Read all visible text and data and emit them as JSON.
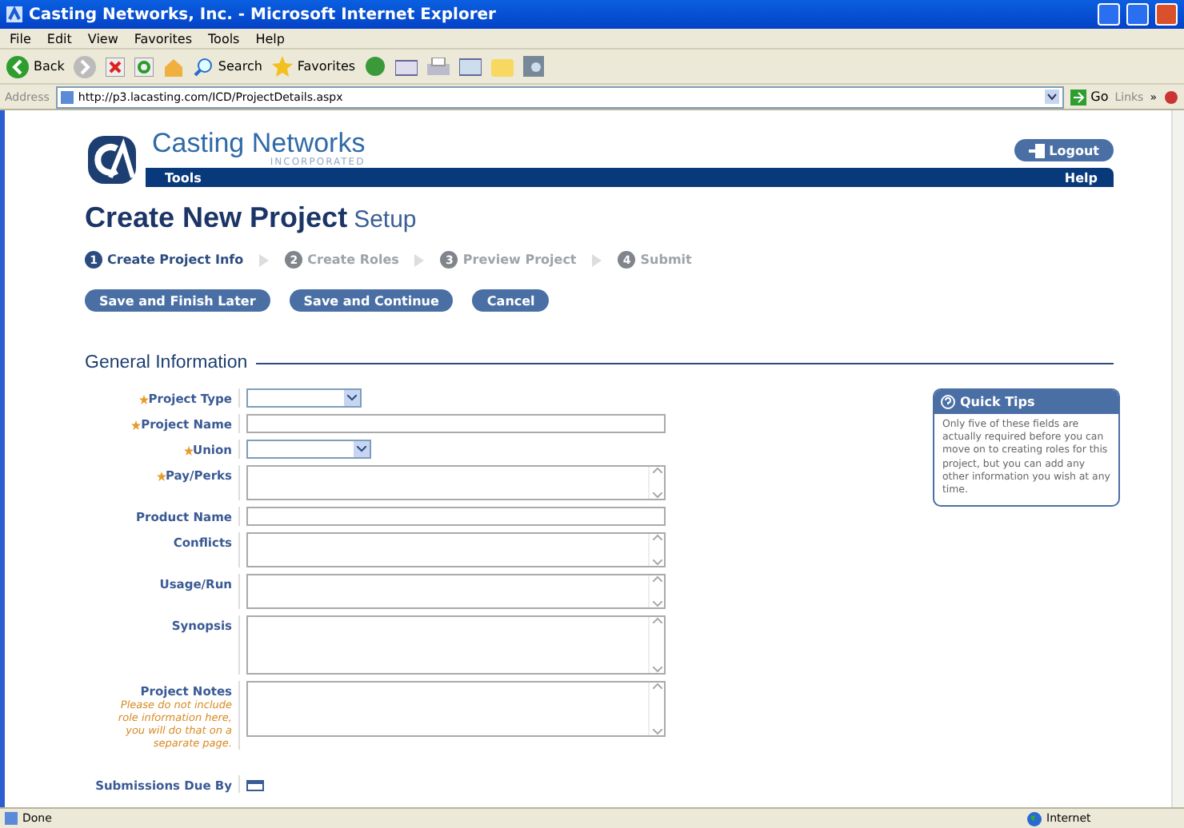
{
  "window": {
    "title": "Casting Networks, Inc. - Microsoft Internet Explorer"
  },
  "menu": [
    "File",
    "Edit",
    "View",
    "Favorites",
    "Tools",
    "Help"
  ],
  "toolbar": {
    "back": "Back",
    "search": "Search",
    "favorites": "Favorites"
  },
  "address": {
    "label": "Address",
    "url": "http://p3.lacasting.com/ICD/ProjectDetails.aspx",
    "go": "Go",
    "links": "Links",
    "more": "»"
  },
  "site": {
    "brand": "Casting Networks",
    "brand_sub": "INCORPORATED",
    "logout": "Logout",
    "nav_left": "Tools",
    "nav_right": "Help"
  },
  "page": {
    "title": "Create New Project",
    "subtitle": "Setup"
  },
  "steps": [
    {
      "number": "1",
      "label": "Create Project Info",
      "selected": true
    },
    {
      "number": "2",
      "label": "Create Roles",
      "selected": false
    },
    {
      "number": "3",
      "label": "Preview Project",
      "selected": false
    },
    {
      "number": "4",
      "label": "Submit",
      "selected": false
    }
  ],
  "buttons": [
    "Save and Finish Later",
    "Save and Continue",
    "Cancel"
  ],
  "section": "General Information",
  "fields": [
    {
      "label": "Project Type",
      "kind": "select",
      "required": true
    },
    {
      "label": "Project Name",
      "kind": "input",
      "required": true
    },
    {
      "label": "Union",
      "kind": "select",
      "required": true
    },
    {
      "label": "Pay/Perks",
      "kind": "textarea",
      "required": true
    },
    {
      "label": "Product Name",
      "kind": "input",
      "required": false
    },
    {
      "label": "Conflicts",
      "kind": "textarea",
      "required": false
    },
    {
      "label": "Usage/Run",
      "kind": "textarea",
      "required": false
    },
    {
      "label": "Synopsis",
      "kind": "bigtextarea",
      "required": false
    },
    {
      "label": "Project Notes",
      "kind": "bigtextarea",
      "required": false,
      "note": "Please do not include role information here, you will do that on a separate page."
    },
    {
      "label": "Submissions Due By",
      "kind": "calendar",
      "required": false
    }
  ],
  "tips": {
    "title": "Quick Tips",
    "text": "Only five of these fields are actually required before you can move on to creating roles for this project, but you can add any other information you wish at any time."
  },
  "status_bar": {
    "text": "Done",
    "zone": "Internet"
  }
}
